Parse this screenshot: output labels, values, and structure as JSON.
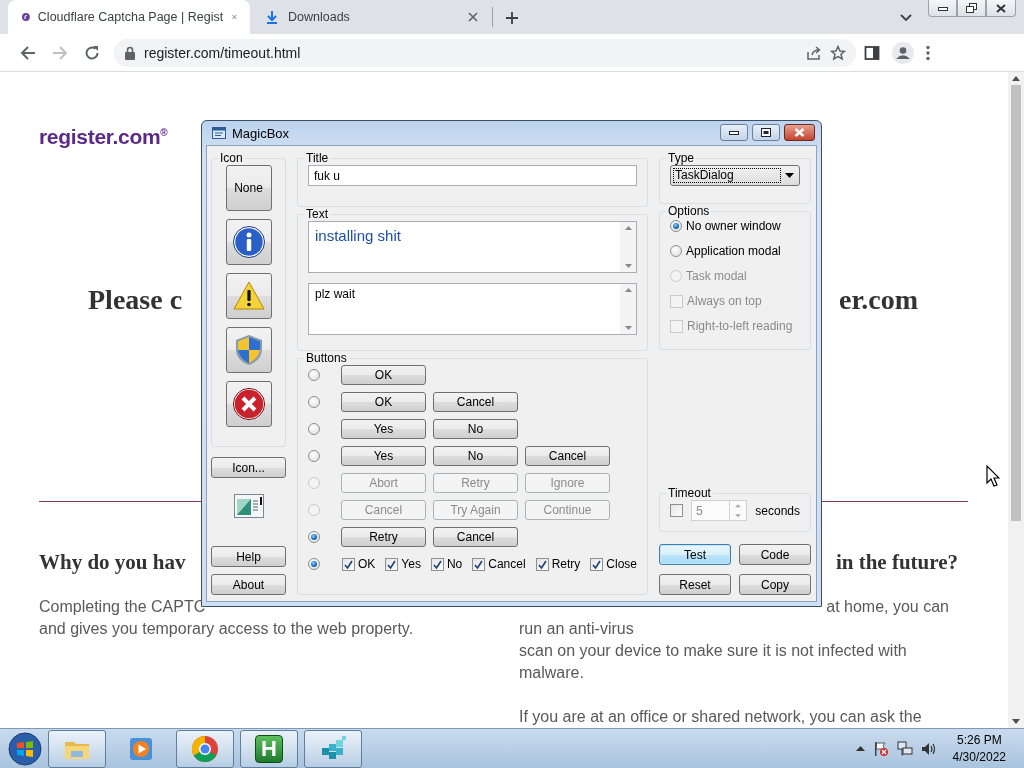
{
  "browser": {
    "tabs": [
      {
        "title": "Cloudflare Captcha Page | Regist",
        "selected": true,
        "kind": "site"
      },
      {
        "title": "Downloads",
        "selected": false,
        "kind": "download"
      }
    ],
    "address": "register.com/timeout.html"
  },
  "page": {
    "logo": "register.com$^{®}$",
    "heading": [
      "Please c",
      "er.com"
    ],
    "subheading": [
      "Why do you hav",
      "in the future?"
    ],
    "left_text": [
      "Completing the CAPTC",
      "and gives you temporary access to the web property."
    ],
    "right_text": [
      "at home, you can",
      "run an anti-virus\nscan on your device to make sure it is not infected with\nmalware.",
      "If you are at an office or shared network, you can ask the"
    ]
  },
  "dialog": {
    "title": "MagicBox",
    "icon_group": {
      "label": "Icon",
      "choices": [
        {
          "kind": "none",
          "label": "None"
        },
        {
          "kind": "info"
        },
        {
          "kind": "warning"
        },
        {
          "kind": "shield"
        },
        {
          "kind": "error"
        }
      ],
      "browse": "Icon...",
      "help": "Help",
      "about": "About"
    },
    "title_group": {
      "label": "Title",
      "value": "fuk u"
    },
    "text_group": {
      "label": "Text",
      "main": "installing shit",
      "content": "plz wait"
    },
    "buttons_group": {
      "label": "Buttons",
      "rows": [
        {
          "kind": "buttons",
          "selected": false,
          "disabled": false,
          "buttons": [
            "OK"
          ]
        },
        {
          "kind": "buttons",
          "selected": false,
          "disabled": false,
          "buttons": [
            "OK",
            "Cancel"
          ]
        },
        {
          "kind": "buttons",
          "selected": false,
          "disabled": false,
          "buttons": [
            "Yes",
            "No"
          ]
        },
        {
          "kind": "buttons",
          "selected": false,
          "disabled": false,
          "buttons": [
            "Yes",
            "No",
            "Cancel"
          ]
        },
        {
          "kind": "buttons",
          "selected": false,
          "disabled": true,
          "buttons": [
            "Abort",
            "Retry",
            "Ignore"
          ]
        },
        {
          "kind": "buttons",
          "selected": false,
          "disabled": true,
          "buttons": [
            "Cancel",
            "Try Again",
            "Continue"
          ]
        },
        {
          "kind": "buttons",
          "selected": true,
          "disabled": false,
          "buttons": [
            "Retry",
            "Cancel"
          ]
        },
        {
          "kind": "checks",
          "selected": true,
          "disabled": false,
          "checks": [
            {
              "label": "OK",
              "checked": true
            },
            {
              "label": "Yes",
              "checked": true
            },
            {
              "label": "No",
              "checked": true
            },
            {
              "label": "Cancel",
              "checked": true
            },
            {
              "label": "Retry",
              "checked": true
            },
            {
              "label": "Close",
              "checked": true
            }
          ]
        }
      ]
    },
    "type_group": {
      "label": "Type",
      "value": "TaskDialog"
    },
    "options_group": {
      "label": "Options",
      "items": [
        {
          "kind": "radio",
          "label": "No owner window",
          "selected": true,
          "disabled": false
        },
        {
          "kind": "radio",
          "label": "Application modal",
          "selected": false,
          "disabled": false
        },
        {
          "kind": "radio",
          "label": "Task modal",
          "selected": false,
          "disabled": true
        },
        {
          "kind": "checkbox",
          "label": "Always on top",
          "checked": false,
          "disabled": true
        },
        {
          "kind": "checkbox",
          "label": "Right-to-left reading",
          "checked": false,
          "disabled": true
        }
      ]
    },
    "timeout_group": {
      "label": "Timeout",
      "checked": false,
      "value": "5",
      "unit": "seconds"
    },
    "actions": [
      {
        "label": "Test",
        "default": true
      },
      {
        "label": "Code",
        "default": false
      },
      {
        "label": "Reset",
        "default": false
      },
      {
        "label": "Copy",
        "default": false
      }
    ]
  },
  "taskbar": {
    "apps": [
      {
        "kind": "folder",
        "running": true
      },
      {
        "kind": "media",
        "running": false
      },
      {
        "kind": "wheel",
        "running": true
      },
      {
        "kind": "letter",
        "letter": "H",
        "running": true
      },
      {
        "kind": "cubes",
        "running": true
      }
    ],
    "time": "5:26 PM",
    "date": "4/30/2022"
  }
}
